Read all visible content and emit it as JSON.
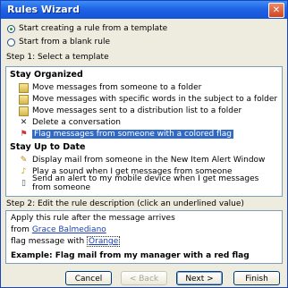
{
  "window": {
    "title": "Rules Wizard",
    "close_label": "✕"
  },
  "start_options": [
    {
      "label": "Start creating a rule from a template",
      "checked": true
    },
    {
      "label": "Start from a blank rule",
      "checked": false
    }
  ],
  "step1_label": "Step 1: Select a template",
  "groups": [
    {
      "header": "Stay Organized",
      "items": [
        {
          "label": "Move messages from someone to a folder",
          "icon": "envelope-move-icon"
        },
        {
          "label": "Move messages with specific words in the subject to a folder",
          "icon": "envelope-move-icon"
        },
        {
          "label": "Move messages sent to a distribution list to a folder",
          "icon": "envelope-move-icon"
        },
        {
          "label": "Delete a conversation",
          "icon": "delete-icon"
        },
        {
          "label": "Flag messages from someone with a colored flag",
          "icon": "flag-icon",
          "selected": true
        }
      ]
    },
    {
      "header": "Stay Up to Date",
      "items": [
        {
          "label": "Display mail from someone in the New Item Alert Window",
          "icon": "alert-window-icon"
        },
        {
          "label": "Play a sound when I get messages from someone",
          "icon": "sound-icon"
        },
        {
          "label": "Send an alert to my mobile device when I get messages from someone",
          "icon": "mobile-icon"
        }
      ]
    }
  ],
  "step2_label": "Step 2: Edit the rule description (click an underlined value)",
  "description": {
    "line1": "Apply this rule after the message arrives",
    "line2_prefix": "from ",
    "line2_link": "Grace Balmediano",
    "line3_prefix": "flag message with ",
    "line3_link": "Orange"
  },
  "example": "Example: Flag mail from my manager with a red flag",
  "buttons": {
    "cancel": "Cancel",
    "back": "< Back",
    "next": "Next >",
    "finish": "Finish"
  },
  "colors": {
    "titlebar": "#1f64e6",
    "selection": "#316ac5",
    "link": "#1a3fb8"
  }
}
